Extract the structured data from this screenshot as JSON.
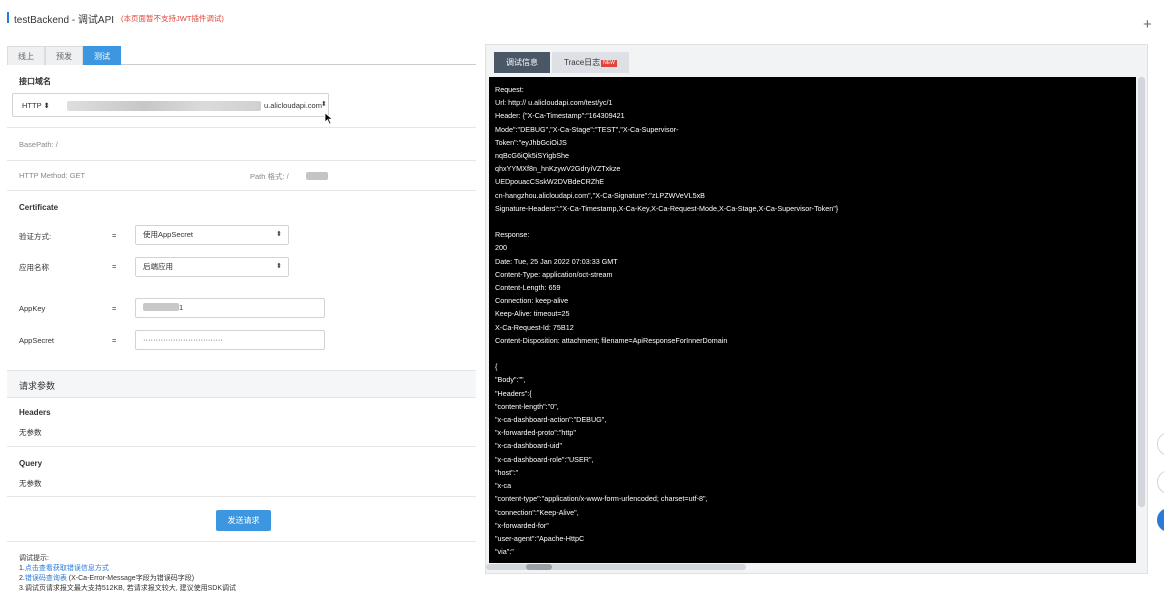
{
  "header": {
    "title": "testBackend - 调试API",
    "note": "(本页面暂不支持JWT插件调试)"
  },
  "add_icon": "+",
  "env_tabs": [
    "线上",
    "预发",
    "测试"
  ],
  "domain": {
    "label": "接口域名",
    "protocol": "HTTP ⬍",
    "suffix": "u.alicloudapi.com",
    "arrows": "⬍"
  },
  "base_path": "BasePath: /",
  "http_method": "HTTP Method: GET",
  "path_format": "Path 格式: /",
  "certificate": {
    "title": "Certificate",
    "auth_label": "验证方式:",
    "auth_eq": "=",
    "auth_value": "使用AppSecret",
    "app_label": "应用名称",
    "app_eq": "=",
    "app_value": "后端应用",
    "appkey_label": "AppKey",
    "appkey_eq": "=",
    "appkey_value": "1",
    "appsecret_label": "AppSecret",
    "appsecret_eq": "=",
    "appsecret_value": "································"
  },
  "params": {
    "title": "请求参数",
    "headers_label": "Headers",
    "headers_empty": "无参数",
    "query_label": "Query",
    "query_empty": "无参数"
  },
  "send_button": "发送请求",
  "tips": {
    "title": "调试提示:",
    "line1_prefix": "1.",
    "line1_link": "点击查看获取错误信息方式",
    "line2_prefix": "2.",
    "line2_link": "错误码查询表",
    "line2_rest": " (X-Ca-Error-Message字段为错误码字段)",
    "line3": "3.调试页请求报文最大支持512KB, 若请求报文较大, 建议使用SDK调试"
  },
  "right_tabs": {
    "debug": "调试信息",
    "trace": "Trace日志",
    "new_badge": "NEW"
  },
  "console_lines": [
    "Request:",
    "Url: http://                                                    u.alicloudapi.com/test/yc/1",
    "Header: {\"X-Ca-Timestamp\":\"164309421",
    "Mode\":\"DEBUG\",\"X-Ca-Stage\":\"TEST\",\"X-Ca-Supervisor-",
    "Token\":\"eyJhbGciOiJS",
    "nqBcG6iQk5iSYigbShe",
    "qhxYYMXf8n_hnKzywV2GdryiVZTxkze",
    "UEDpouacCSskW2DVBdeCRZhE",
    "cn-hangzhou.alicloudapi.com\",\"X-Ca-Signature\":\"zLPZWVeVL5xB",
    "Signature-Headers\":\"X-Ca-Timestamp,X-Ca-Key,X-Ca-Request-Mode,X-Ca-Stage,X-Ca-Supervisor-Token\"}",
    "",
    "Response:",
    "200",
    "Date: Tue, 25 Jan 2022 07:03:33 GMT",
    "Content-Type: application/oct-stream",
    "Content-Length: 659",
    "Connection: keep-alive",
    "Keep-Alive: timeout=25",
    "X-Ca-Request-Id: 75B12",
    "Content-Disposition: attachment; filename=ApiResponseForInnerDomain",
    "",
    "{",
    "\"Body\":\"\",",
    "\"Headers\":{",
    "\"content-length\":\"0\",",
    "\"x-ca-dashboard-action\":\"DEBUG\",",
    "\"x-forwarded-proto\":\"http\"",
    "\"x-ca-dashboard-uid\"",
    "\"x-ca-dashboard-role\":\"USER\",",
    "\"host\":\"",
    "\"x-ca",
    "\"content-type\":\"application/x-www-form-urlencoded; charset=utf-8\",",
    "\"connection\":\"Keep-Alive\",",
    "\"x-forwarded-for\"",
    "\"user-agent\":\"Apache-HttpC",
    "\"via\":\""
  ]
}
